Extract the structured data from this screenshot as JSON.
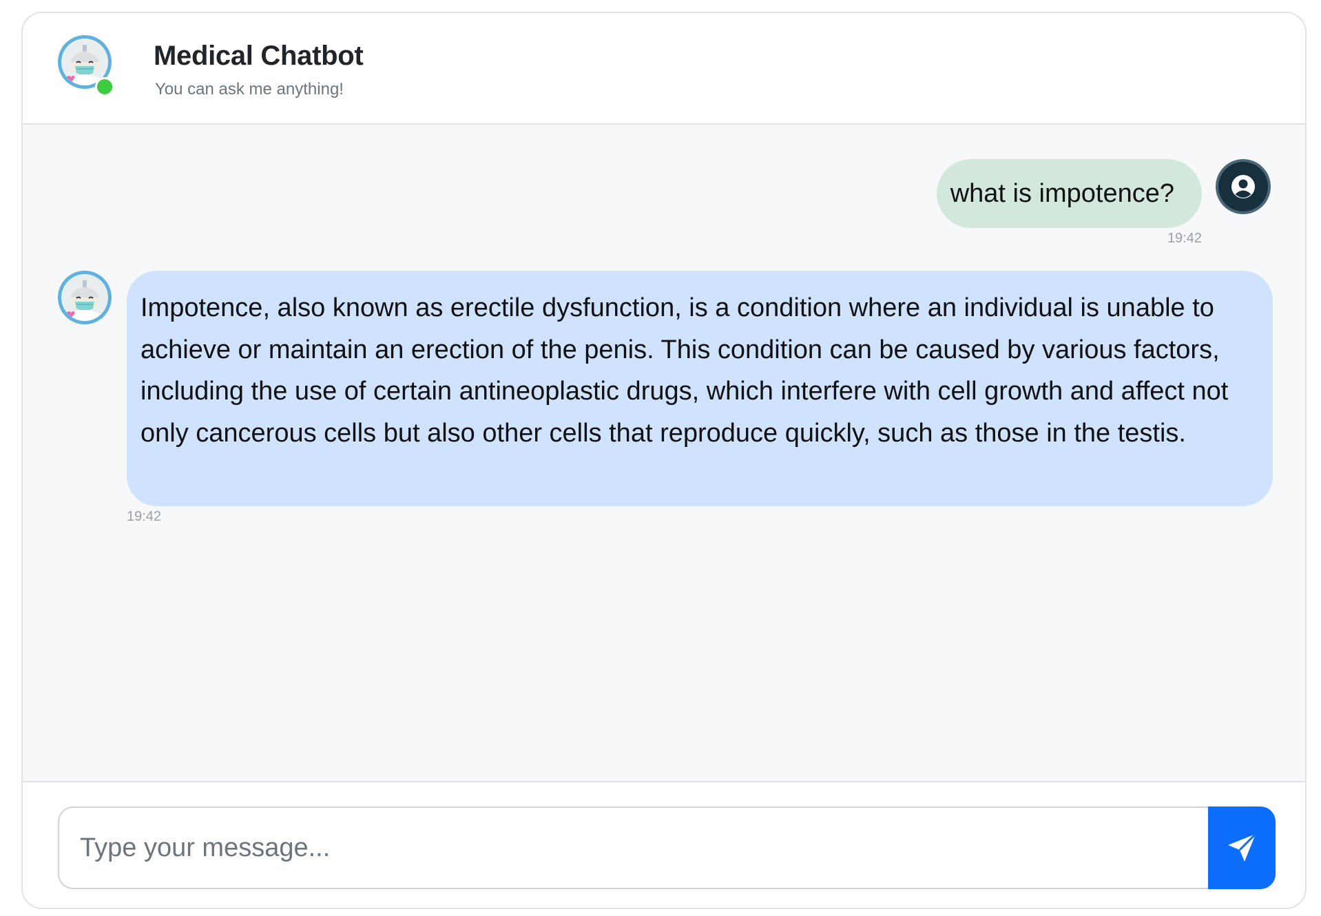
{
  "header": {
    "title": "Medical Chatbot",
    "subtitle": "You can ask me anything!",
    "status": "online",
    "status_color": "#3dcb3f"
  },
  "messages": [
    {
      "role": "user",
      "text": "what is impotence?",
      "time": "19:42",
      "bubble_color": "#d2e8dc"
    },
    {
      "role": "bot",
      "text": "Impotence, also known as erectile dysfunction, is a condition where an individual is unable to achieve or maintain an erection of the penis. This condition can be caused by various factors, including the use of certain antineoplastic drugs, which interfere with cell growth and affect not only cancerous cells but also other cells that reproduce quickly, such as those in the testis.",
      "time": "19:42",
      "bubble_color": "#cfe2fe"
    }
  ],
  "composer": {
    "placeholder": "Type your message...",
    "value": "",
    "send_icon": "send-icon",
    "accent_color": "#0d6efd"
  },
  "icons": {
    "bot_avatar": "doctor-mascot-icon",
    "user_avatar": "user-icon"
  }
}
